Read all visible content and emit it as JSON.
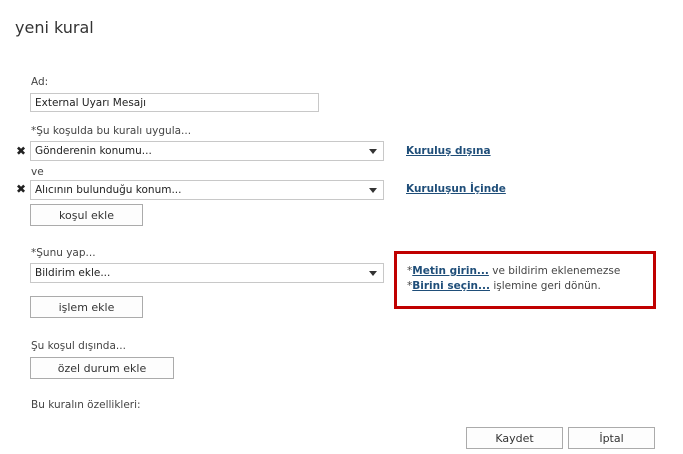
{
  "page": {
    "title": "yeni kural"
  },
  "name": {
    "label": "Ad:",
    "value": "External Uyarı Mesajı"
  },
  "condition": {
    "label": "*Şu koşulda bu kuralı uygula...",
    "rows": [
      {
        "select_value": "Gönderenin konumu...",
        "link": "Kuruluş dışına"
      },
      {
        "select_value": "Alıcının bulunduğu konum...",
        "link": "Kuruluşun İçinde"
      }
    ],
    "connector": "ve",
    "add_button": "koşul ekle"
  },
  "action": {
    "label": "*Şunu yap...",
    "select_value": "Bildirim ekle...",
    "add_button": "işlem ekle",
    "callout": {
      "star1": "*",
      "link1": "Metin girin...",
      "text1": " ve bildirim eklenemezse *",
      "link2": "Birini seçin...",
      "text2": " işlemine geri dönün."
    }
  },
  "exception": {
    "label": "Şu koşul dışında...",
    "add_button": "özel durum ekle"
  },
  "properties": {
    "label": "Bu kuralın özellikleri:"
  },
  "footer": {
    "save": "Kaydet",
    "cancel": "İptal"
  },
  "colors": {
    "highlight_border": "#c00000",
    "link": "#1f4e79"
  }
}
